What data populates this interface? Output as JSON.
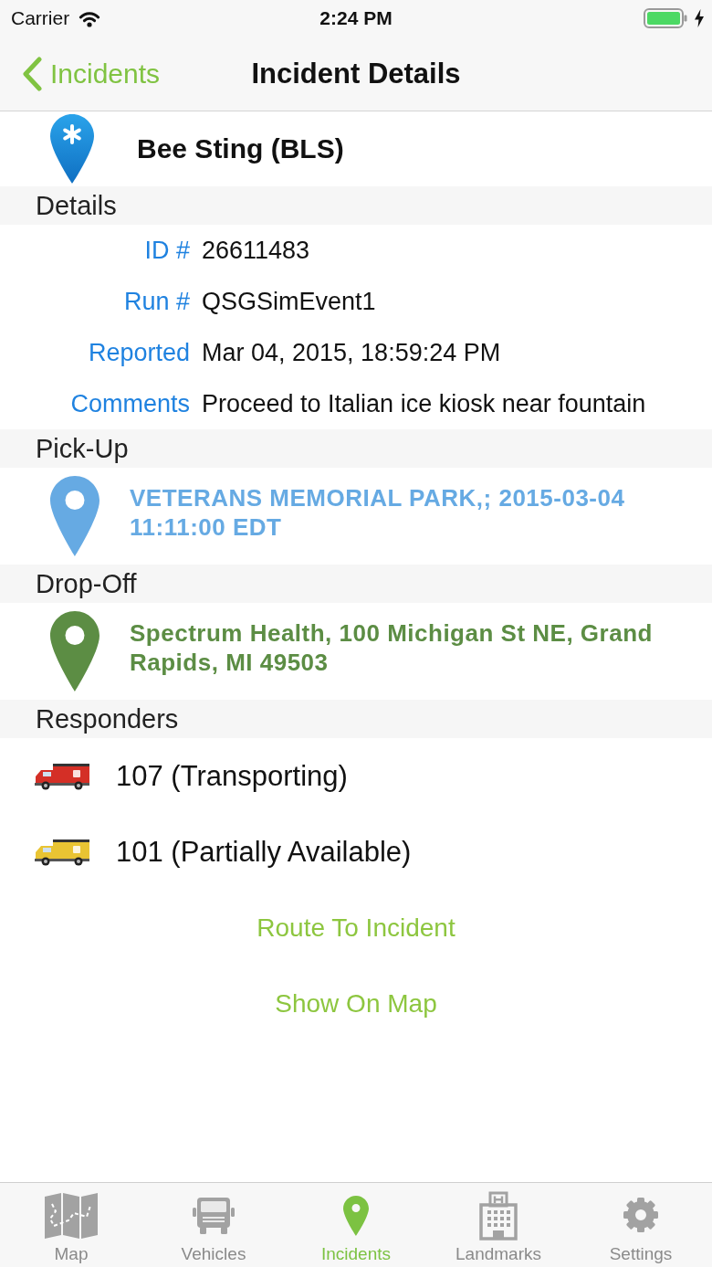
{
  "status_bar": {
    "carrier": "Carrier",
    "time": "2:24 PM"
  },
  "nav_bar": {
    "back_label": "Incidents",
    "title": "Incident Details"
  },
  "incident": {
    "title": "Bee Sting (BLS)"
  },
  "details": {
    "heading": "Details",
    "fields": [
      {
        "label": "ID #",
        "value": "26611483"
      },
      {
        "label": "Run #",
        "value": "QSGSimEvent1"
      },
      {
        "label": "Reported",
        "value": "Mar 04, 2015, 18:59:24 PM"
      },
      {
        "label": "Comments",
        "value": "Proceed to Italian ice kiosk near fountain"
      }
    ]
  },
  "locations": [
    {
      "heading": "Pick-Up",
      "address": "VETERANS MEMORIAL PARK,; 2015-03-04 11:11:00 EDT",
      "color": "#66aae3"
    },
    {
      "heading": "Drop-Off",
      "address": "Spectrum Health, 100 Michigan St NE, Grand Rapids, MI 49503",
      "color": "#5c8d44"
    }
  ],
  "responders": {
    "heading": "Responders",
    "items": [
      {
        "label": "107 (Transporting)",
        "color": "#d42f26"
      },
      {
        "label": "101 (Partially Available)",
        "color": "#e9c433"
      }
    ]
  },
  "actions": [
    "Route To Incident",
    "Show On Map"
  ],
  "tab_bar": [
    {
      "label": "Map",
      "selected": false
    },
    {
      "label": "Vehicles",
      "selected": false
    },
    {
      "label": "Incidents",
      "selected": true
    },
    {
      "label": "Landmarks",
      "selected": false
    },
    {
      "label": "Settings",
      "selected": false
    }
  ]
}
